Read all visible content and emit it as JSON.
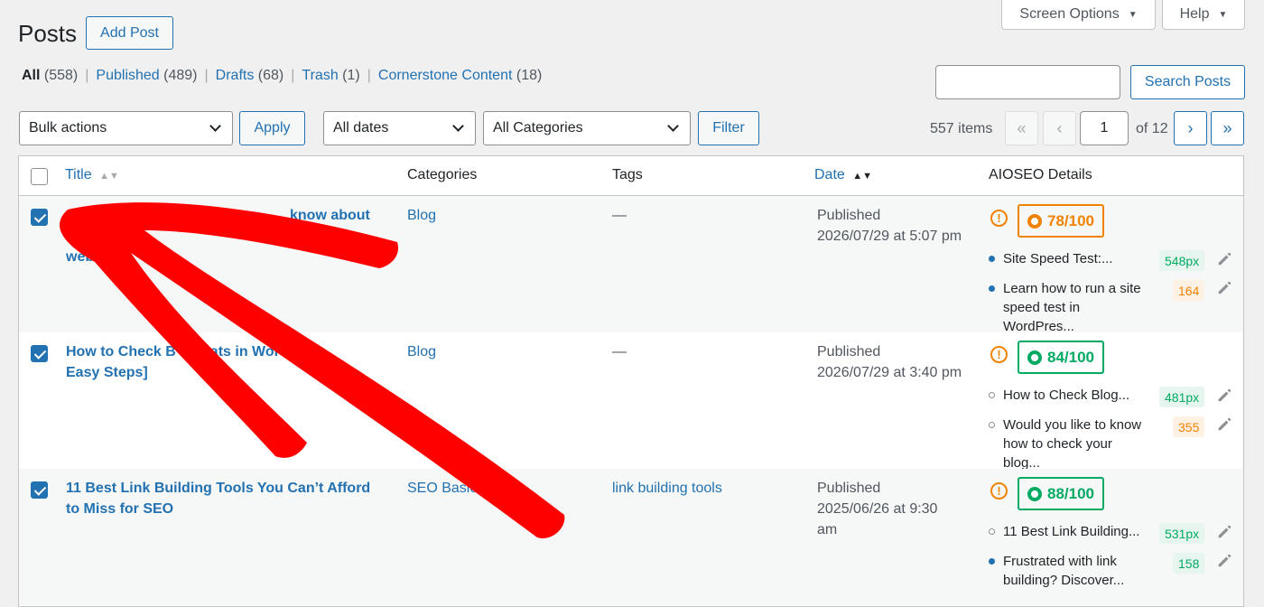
{
  "header": {
    "title": "Posts",
    "add_post": "Add Post",
    "screen_options": "Screen Options",
    "help": "Help"
  },
  "views": {
    "all": {
      "label": "All",
      "count": "(558)"
    },
    "published": {
      "label": "Published",
      "count": "(489)"
    },
    "drafts": {
      "label": "Drafts",
      "count": "(68)"
    },
    "trash": {
      "label": "Trash",
      "count": "(1)"
    },
    "cornerstone": {
      "label": "Cornerstone Content",
      "count": "(18)"
    },
    "separator": "|"
  },
  "search": {
    "value": "",
    "button": "Search Posts"
  },
  "filters": {
    "bulk_actions": "Bulk actions",
    "apply": "Apply",
    "dates": "All dates",
    "categories": "All Categories",
    "filter": "Filter"
  },
  "pagination": {
    "items": "557 items",
    "first": "«",
    "prev": "‹",
    "current": "1",
    "of": "of 12",
    "next": "›",
    "last": "»"
  },
  "table": {
    "columns": {
      "title": "Title",
      "categories": "Categories",
      "tags": "Tags",
      "date": "Date",
      "aioseo": "AIOSEO Details"
    },
    "rows": [
      {
        "title_line1": "know about",
        "title_line2": "te",
        "title_line3": "web",
        "category": "Blog",
        "tags": "—",
        "status": "Published",
        "date": "2026/07/29 at 5:07 pm",
        "warn": "!",
        "score": "78/100",
        "meta_title": "Site Speed Test:...",
        "meta_title_px": "548px",
        "meta_desc": "Learn how to run a site speed test in WordPres...",
        "meta_desc_len": "164"
      },
      {
        "title_line1": "How to Check B",
        "title_line1b": "ats in WordP",
        "title_line2": "Easy Steps]",
        "category": "Blog",
        "tags": "—",
        "status": "Published",
        "date": "2026/07/29 at 3:40 pm",
        "warn": "!",
        "score": "84/100",
        "meta_title": "How to Check Blog...",
        "meta_title_px": "481px",
        "meta_desc": "Would you like to know how to check your blog...",
        "meta_desc_len": "355"
      },
      {
        "title_line1": "11 Best Link Building Tools You Can’t Afford",
        "title_line2": "to Miss for SEO",
        "category": "SEO Basics",
        "tags": "link building tools",
        "status": "Published",
        "date": "2025/06/26 at 9:30 am",
        "warn": "!",
        "score": "88/100",
        "meta_title": "11 Best Link Building...",
        "meta_title_px": "531px",
        "meta_desc": "Frustrated with link building? Discover...",
        "meta_desc_len": "158"
      }
    ]
  },
  "colors": {
    "link": "#2271b1",
    "score_orange": "#f18200",
    "score_green": "#00aa63",
    "annotation_arrow": "#ff0000"
  }
}
